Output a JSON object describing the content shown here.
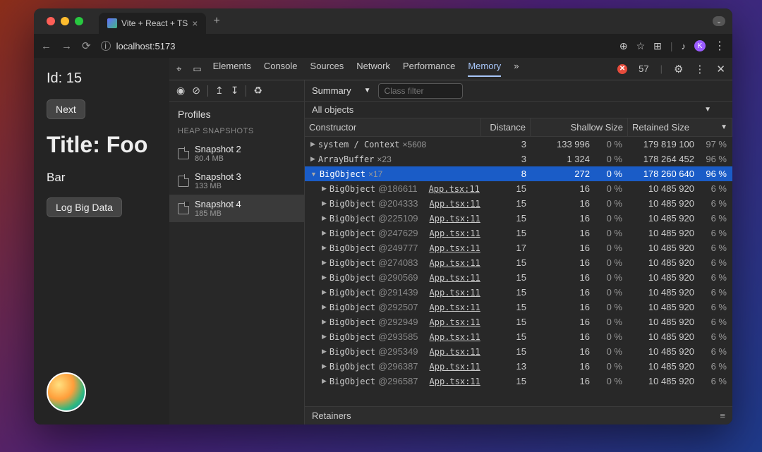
{
  "browser": {
    "tab_title": "Vite + React + TS",
    "url": "localhost:5173",
    "avatar_letter": "K"
  },
  "app": {
    "id_label": "Id: 15",
    "next_btn": "Next",
    "title": "Title: Foo",
    "subtitle": "Bar",
    "log_btn": "Log Big Data"
  },
  "devtools": {
    "tabs": [
      "Elements",
      "Console",
      "Sources",
      "Network",
      "Performance",
      "Memory"
    ],
    "active_tab": "Memory",
    "error_count": "57",
    "profiles_label": "Profiles",
    "heap_label": "HEAP SNAPSHOTS",
    "snapshots": [
      {
        "name": "Snapshot 2",
        "size": "80.4 MB"
      },
      {
        "name": "Snapshot 3",
        "size": "133 MB"
      },
      {
        "name": "Snapshot 4",
        "size": "185 MB"
      }
    ],
    "selected_snapshot": 2,
    "summary_label": "Summary",
    "class_filter_placeholder": "Class filter",
    "all_objects_label": "All objects",
    "headers": {
      "constructor": "Constructor",
      "distance": "Distance",
      "shallow": "Shallow Size",
      "retained": "Retained Size"
    },
    "top_rows": [
      {
        "name": "system / Context",
        "count": "×5608",
        "distance": "3",
        "shallow": "133 996",
        "shallow_pct": "0 %",
        "retained": "179 819 100",
        "retained_pct": "97 %"
      },
      {
        "name": "ArrayBuffer",
        "count": "×23",
        "distance": "3",
        "shallow": "1 324",
        "shallow_pct": "0 %",
        "retained": "178 264 452",
        "retained_pct": "96 %"
      }
    ],
    "selected_row": {
      "name": "BigObject",
      "count": "×17",
      "distance": "8",
      "shallow": "272",
      "shallow_pct": "0 %",
      "retained": "178 260 640",
      "retained_pct": "96 %"
    },
    "instances": [
      {
        "name": "BigObject",
        "id": "@186611",
        "src": "App.tsx:11",
        "distance": "15",
        "shallow": "16",
        "shallow_pct": "0 %",
        "retained": "10 485 920",
        "retained_pct": "6 %"
      },
      {
        "name": "BigObject",
        "id": "@204333",
        "src": "App.tsx:11",
        "distance": "15",
        "shallow": "16",
        "shallow_pct": "0 %",
        "retained": "10 485 920",
        "retained_pct": "6 %"
      },
      {
        "name": "BigObject",
        "id": "@225109",
        "src": "App.tsx:11",
        "distance": "15",
        "shallow": "16",
        "shallow_pct": "0 %",
        "retained": "10 485 920",
        "retained_pct": "6 %"
      },
      {
        "name": "BigObject",
        "id": "@247629",
        "src": "App.tsx:11",
        "distance": "15",
        "shallow": "16",
        "shallow_pct": "0 %",
        "retained": "10 485 920",
        "retained_pct": "6 %"
      },
      {
        "name": "BigObject",
        "id": "@249777",
        "src": "App.tsx:11",
        "distance": "17",
        "shallow": "16",
        "shallow_pct": "0 %",
        "retained": "10 485 920",
        "retained_pct": "6 %"
      },
      {
        "name": "BigObject",
        "id": "@274083",
        "src": "App.tsx:11",
        "distance": "15",
        "shallow": "16",
        "shallow_pct": "0 %",
        "retained": "10 485 920",
        "retained_pct": "6 %"
      },
      {
        "name": "BigObject",
        "id": "@290569",
        "src": "App.tsx:11",
        "distance": "15",
        "shallow": "16",
        "shallow_pct": "0 %",
        "retained": "10 485 920",
        "retained_pct": "6 %"
      },
      {
        "name": "BigObject",
        "id": "@291439",
        "src": "App.tsx:11",
        "distance": "15",
        "shallow": "16",
        "shallow_pct": "0 %",
        "retained": "10 485 920",
        "retained_pct": "6 %"
      },
      {
        "name": "BigObject",
        "id": "@292507",
        "src": "App.tsx:11",
        "distance": "15",
        "shallow": "16",
        "shallow_pct": "0 %",
        "retained": "10 485 920",
        "retained_pct": "6 %"
      },
      {
        "name": "BigObject",
        "id": "@292949",
        "src": "App.tsx:11",
        "distance": "15",
        "shallow": "16",
        "shallow_pct": "0 %",
        "retained": "10 485 920",
        "retained_pct": "6 %"
      },
      {
        "name": "BigObject",
        "id": "@293585",
        "src": "App.tsx:11",
        "distance": "15",
        "shallow": "16",
        "shallow_pct": "0 %",
        "retained": "10 485 920",
        "retained_pct": "6 %"
      },
      {
        "name": "BigObject",
        "id": "@295349",
        "src": "App.tsx:11",
        "distance": "15",
        "shallow": "16",
        "shallow_pct": "0 %",
        "retained": "10 485 920",
        "retained_pct": "6 %"
      },
      {
        "name": "BigObject",
        "id": "@296387",
        "src": "App.tsx:11",
        "distance": "13",
        "shallow": "16",
        "shallow_pct": "0 %",
        "retained": "10 485 920",
        "retained_pct": "6 %"
      },
      {
        "name": "BigObject",
        "id": "@296587",
        "src": "App.tsx:11",
        "distance": "15",
        "shallow": "16",
        "shallow_pct": "0 %",
        "retained": "10 485 920",
        "retained_pct": "6 %"
      }
    ],
    "retainers_label": "Retainers"
  }
}
